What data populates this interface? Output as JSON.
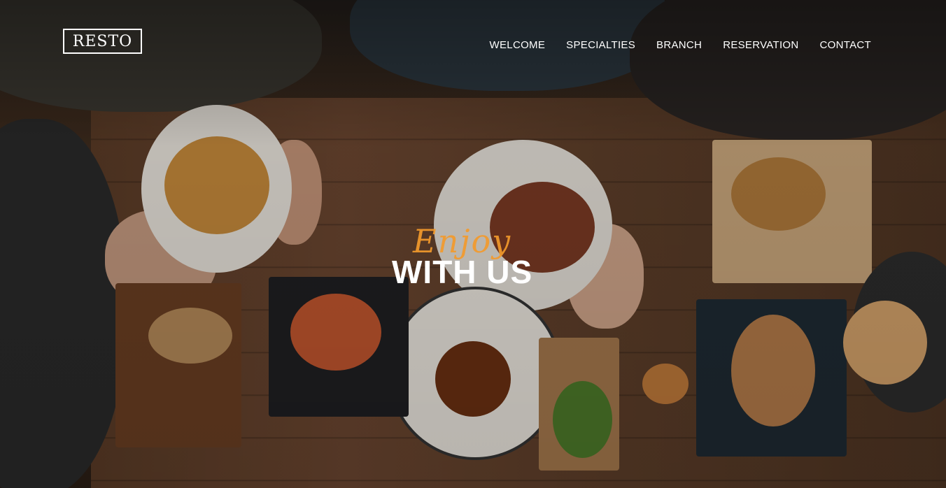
{
  "header": {
    "logo": "RESTO",
    "nav": [
      "WELCOME",
      "SPECIALTIES",
      "BRANCH",
      "RESERVATION",
      "CONTACT"
    ]
  },
  "hero": {
    "script_text": "Enjoy",
    "main_text": "WITH US",
    "accent_color": "#f39a2c"
  }
}
